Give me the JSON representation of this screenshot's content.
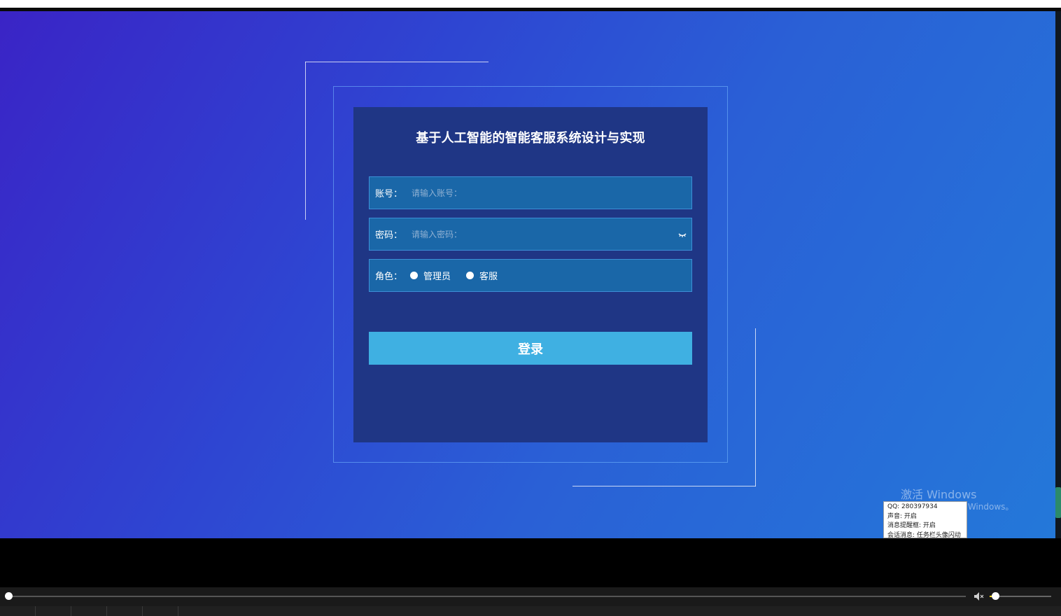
{
  "app": {
    "title": "基于人工智能的智能客服系统设计与实现"
  },
  "form": {
    "account": {
      "label": "账号：",
      "placeholder": "请输入账号：",
      "value": ""
    },
    "password": {
      "label": "密码：",
      "placeholder": "请输入密码：",
      "value": "",
      "icon": "eye-icon"
    },
    "role": {
      "label": "角色：",
      "options": [
        "管理员",
        "客服"
      ],
      "selected": ""
    },
    "login_label": "登录"
  },
  "overlay": {
    "activate_title": "激活 Windows",
    "activate_sub": "以激活 Windows。",
    "qq_lines": [
      "QQ: 280397934",
      "声音: 开启",
      "消息提醒框: 开启",
      "会话消息: 任务栏头像闪动"
    ]
  },
  "player": {
    "progress": 0.0,
    "volume": 0.09
  },
  "colors": {
    "panel": "#1f3685",
    "field": "#1a67a8",
    "button": "#3fb0e2"
  }
}
